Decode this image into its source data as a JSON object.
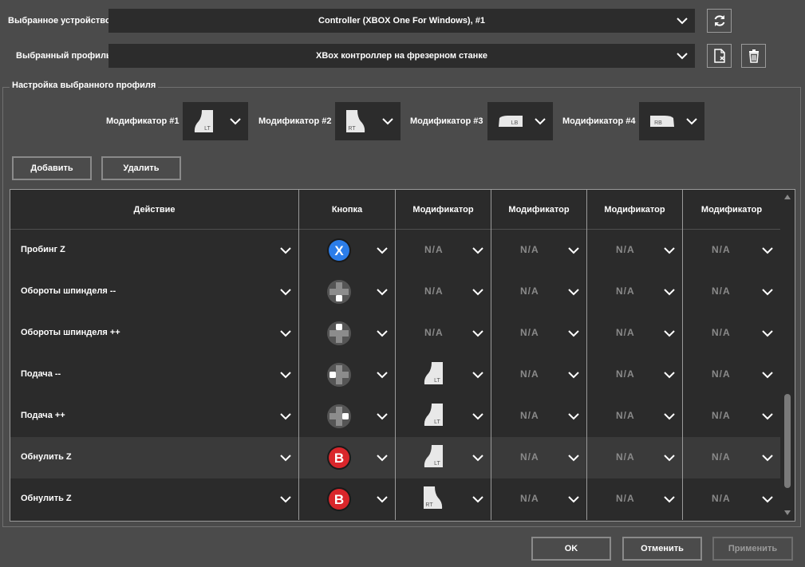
{
  "device": {
    "label": "Выбранное устройство",
    "value": "Controller (XBOX One For Windows), #1"
  },
  "profile": {
    "label": "Выбранный профиль",
    "value": "XBox контроллер на фрезерном станке"
  },
  "settings_group": {
    "title": "Настройка выбранного профиля",
    "modifiers": [
      {
        "label": "Модификатор #1",
        "icon": "lt-trigger-icon"
      },
      {
        "label": "Модификатор #2",
        "icon": "rt-trigger-icon"
      },
      {
        "label": "Модификатор #3",
        "icon": "lb-bumper-icon"
      },
      {
        "label": "Модификатор #4",
        "icon": "rb-bumper-icon"
      }
    ],
    "add_label": "Добавить",
    "delete_label": "Удалить"
  },
  "table": {
    "headers": [
      "Действие",
      "Кнопка",
      "Модификатор",
      "Модификатор",
      "Модификатор",
      "Модификатор"
    ],
    "rows": [
      {
        "action": "Пробинг Z",
        "button": "x-button-icon",
        "mods": [
          "N/A",
          "N/A",
          "N/A",
          "N/A"
        ]
      },
      {
        "action": "Обороты шпинделя --",
        "button": "dpad-down-icon",
        "mods": [
          "N/A",
          "N/A",
          "N/A",
          "N/A"
        ]
      },
      {
        "action": "Обороты шпинделя ++",
        "button": "dpad-up-icon",
        "mods": [
          "N/A",
          "N/A",
          "N/A",
          "N/A"
        ]
      },
      {
        "action": "Подача --",
        "button": "dpad-left-icon",
        "mods": [
          "lt-trigger-icon",
          "N/A",
          "N/A",
          "N/A"
        ]
      },
      {
        "action": "Подача ++",
        "button": "dpad-right-icon",
        "mods": [
          "lt-trigger-icon",
          "N/A",
          "N/A",
          "N/A"
        ]
      },
      {
        "action": "Обнулить Z",
        "button": "b-button-icon",
        "mods": [
          "lt-trigger-icon",
          "N/A",
          "N/A",
          "N/A"
        ]
      },
      {
        "action": "Обнулить Z",
        "button": "b-button-icon",
        "mods": [
          "rt-trigger-icon",
          "N/A",
          "N/A",
          "N/A"
        ]
      }
    ]
  },
  "footer": {
    "ok_label": "OK",
    "cancel_label": "Отменить",
    "apply_label": "Применить"
  },
  "icon_labels": {
    "lt": "LT",
    "rt": "RT",
    "lb": "LB",
    "rb": "RB",
    "x": "X",
    "b": "B"
  },
  "colors": {
    "x_button": "#2b7de9",
    "b_button": "#d9262b",
    "background": "#4b4b4b",
    "panel": "#2c2c2c"
  }
}
